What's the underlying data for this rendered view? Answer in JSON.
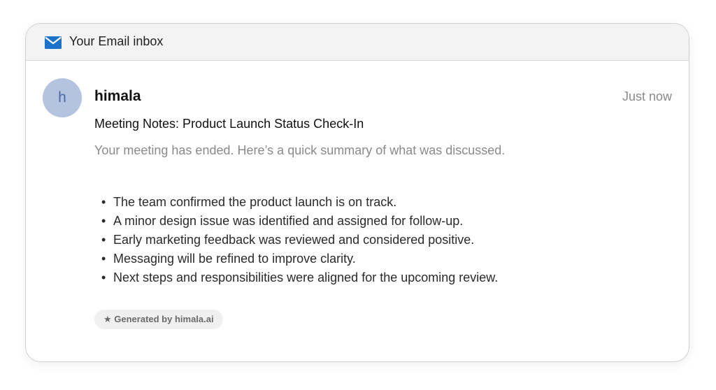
{
  "header": {
    "title": "Your Email inbox",
    "icon": "mail-icon"
  },
  "email": {
    "avatar_letter": "h",
    "sender": "himala",
    "timestamp": "Just now",
    "subject": "Meeting Notes: Product Launch Status Check-In",
    "preview": "Your meeting has ended. Here’s a quick summary of what was discussed.",
    "notes": [
      "The team confirmed the product launch is on track.",
      "A minor design issue was identified and assigned for follow-up.",
      "Early marketing feedback was reviewed and considered positive.",
      "Messaging will be refined to improve clarity.",
      "Next steps and responsibilities were aligned for the upcoming review."
    ],
    "badge": "★ Generated by himala.ai"
  },
  "colors": {
    "accent": "#1a73c8",
    "avatar_bg": "#b3c3e0",
    "avatar_text": "#4a6aa3"
  }
}
